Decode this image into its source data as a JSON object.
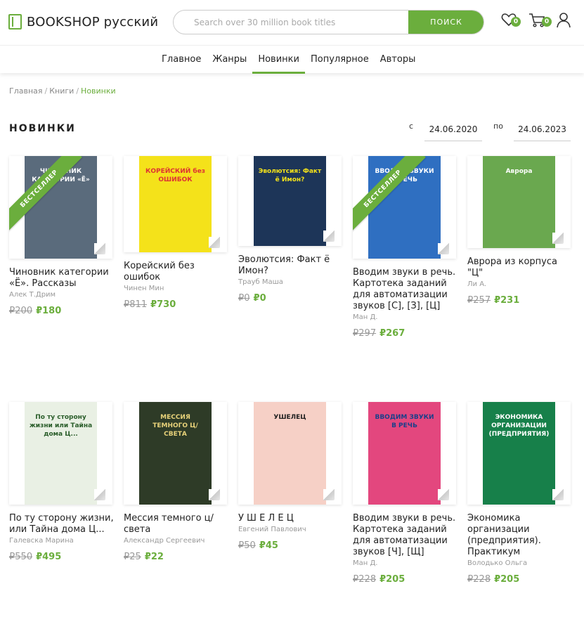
{
  "header": {
    "logo_text": "BOOKSHOP русский",
    "search_placeholder": "Search over 30 million book titles",
    "search_button": "ПОИСК",
    "wishlist_count": "0",
    "cart_count": "0"
  },
  "nav": {
    "items": [
      {
        "label": "Главное"
      },
      {
        "label": "Жанры"
      },
      {
        "label": "Новинки"
      },
      {
        "label": "Популярное"
      },
      {
        "label": "Авторы"
      }
    ],
    "active_index": 2
  },
  "breadcrumb": [
    {
      "label": "Главная"
    },
    {
      "label": "Книги"
    },
    {
      "label": "Новинки"
    }
  ],
  "page_title": "НОВИНКИ",
  "filter": {
    "from_label": "с",
    "from_value": "24.06.2020",
    "to_label": "по",
    "to_value": "24.06.2023"
  },
  "badge_text": "БЕСТСЕЛЛЕР",
  "books": [
    {
      "title": "Чиновник категории «Ё». Рассказы",
      "author": "Алек Т.Дрим",
      "old_price": "₽200",
      "price": "₽180",
      "bestseller": true,
      "cover_color": "#5a6b7c",
      "cover_text": "ЧИНОВНИК КАТЕГОРИИ «Ё»"
    },
    {
      "title": "Корейский без ошибок",
      "author": "Чинен Мин",
      "old_price": "₽811",
      "price": "₽730",
      "bestseller": false,
      "cover_color": "#f4e21a",
      "cover_text": "КОРЕЙСКИЙ без ОШИБОК"
    },
    {
      "title": "Эволютсия: Факт ё Имон?",
      "author": "Трауб Маша",
      "old_price": "₽0",
      "price": "₽0",
      "bestseller": false,
      "cover_color": "#1d3558",
      "cover_text": "Эволютсия: Факт ё Имон?"
    },
    {
      "title": "Вводим звуки в речь. Картотека заданий для автоматизации звуков [С], [З], [Ц]",
      "author": "Ман Д.",
      "old_price": "₽297",
      "price": "₽267",
      "bestseller": true,
      "cover_color": "#2f6fc1",
      "cover_text": "ВВОДИМ ЗВУКИ В РЕЧЬ"
    },
    {
      "title": "Аврора из корпуса \"Ц\"",
      "author": "Ли А.",
      "old_price": "₽257",
      "price": "₽231",
      "bestseller": false,
      "cover_color": "#6aa84f",
      "cover_text": "Аврора"
    },
    {
      "title": "По ту сторону жизни, или Тайна дома Ц...",
      "author": "Галевска Марина",
      "old_price": "₽550",
      "price": "₽495",
      "bestseller": false,
      "cover_color": "#e9f0e4",
      "cover_text": "По ту сторону жизни или Тайна дома Ц..."
    },
    {
      "title": "Мессия темного ц/света",
      "author": "Александр Сергеевич",
      "old_price": "₽25",
      "price": "₽22",
      "bestseller": false,
      "cover_color": "#2e3b27",
      "cover_text": "МЕССИЯ ТЕМНОГО Ц/СВЕТА"
    },
    {
      "title": "У Ш Е Л Е Ц",
      "author": "Евгений Павлович",
      "old_price": "₽50",
      "price": "₽45",
      "bestseller": false,
      "cover_color": "#f6d0c6",
      "cover_text": "УШЕЛЕЦ"
    },
    {
      "title": "Вводим звуки в речь. Картотека заданий для автоматизации звуков [Ч], [Щ]",
      "author": "Ман Д.",
      "old_price": "₽228",
      "price": "₽205",
      "bestseller": false,
      "cover_color": "#e3477e",
      "cover_text": "ВВОДИМ ЗВУКИ В РЕЧЬ"
    },
    {
      "title": "Экономика организации (предприятия). Практикум",
      "author": "Володько Ольга",
      "old_price": "₽228",
      "price": "₽205",
      "bestseller": false,
      "cover_color": "#17804a",
      "cover_text": "ЭКОНОМИКА ОРГАНИЗАЦИИ (ПРЕДПРИЯТИЯ)"
    }
  ]
}
